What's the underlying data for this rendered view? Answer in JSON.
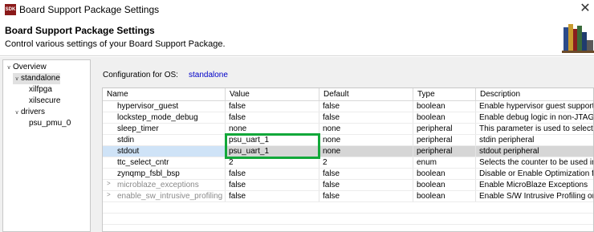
{
  "window": {
    "title": "Board Support Package Settings",
    "icon_text": "SDK",
    "close_label": "✕"
  },
  "header": {
    "title": "Board Support Package Settings",
    "description": "Control various settings of your Board Support Package."
  },
  "tree": {
    "items": [
      {
        "label": "Overview",
        "toggle": "∨"
      },
      {
        "label": "standalone",
        "toggle": "∨",
        "selected": true
      },
      {
        "label": "xilfpga"
      },
      {
        "label": "xilsecure"
      },
      {
        "label": "drivers",
        "toggle": "∨"
      },
      {
        "label": "psu_pmu_0"
      }
    ]
  },
  "config": {
    "label": "Configuration for OS:",
    "os": "standalone"
  },
  "table": {
    "columns": [
      "Name",
      "Value",
      "Default",
      "Type",
      "Description"
    ],
    "rows": [
      {
        "name": "hypervisor_guest",
        "value": "false",
        "default": "false",
        "type": "boolean",
        "description": "Enable hypervisor guest support"
      },
      {
        "name": "lockstep_mode_debug",
        "value": "false",
        "default": "false",
        "type": "boolean",
        "description": "Enable debug logic in non-JTAG"
      },
      {
        "name": "sleep_timer",
        "value": "none",
        "default": "none",
        "type": "peripheral",
        "description": "This parameter is used to select s"
      },
      {
        "name": "stdin",
        "value": "psu_uart_1",
        "default": "none",
        "type": "peripheral",
        "description": "stdin peripheral"
      },
      {
        "name": "stdout",
        "value": "psu_uart_1",
        "default": "none",
        "type": "peripheral",
        "description": "stdout peripheral"
      },
      {
        "name": "ttc_select_cntr",
        "value": "2",
        "default": "2",
        "type": "enum",
        "description": "Selects the counter to be used in"
      },
      {
        "name": "zynqmp_fsbl_bsp",
        "value": "false",
        "default": "false",
        "type": "boolean",
        "description": "Disable or Enable Optimization f"
      },
      {
        "name": "microblaze_exceptions",
        "value": "false",
        "default": "false",
        "type": "boolean",
        "description": "Enable MicroBlaze Exceptions",
        "expander": ">"
      },
      {
        "name": "enable_sw_intrusive_profiling",
        "value": "false",
        "default": "false",
        "type": "boolean",
        "description": "Enable S/W Intrusive Profiling or",
        "expander": ">"
      }
    ]
  },
  "colors": {
    "highlight": "#12a83a",
    "link": "#0000c8",
    "selection": "#cfe3f7"
  }
}
